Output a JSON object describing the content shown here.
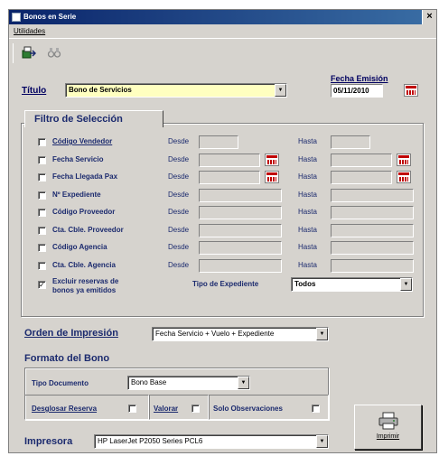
{
  "window": {
    "title": "Bonos en Serie",
    "close_glyph": "×"
  },
  "menu": {
    "utilidades": "Utilidades"
  },
  "toolbar": {
    "items": [
      "export-icon",
      "binoculars-icon"
    ]
  },
  "header": {
    "titulo_label": "Título",
    "titulo_value": "Bono de Servicios",
    "fecha_label": "Fecha Emisión",
    "fecha_value": "05/11/2010"
  },
  "filtro": {
    "tab_label": "Filtro de Selección",
    "desde": "Desde",
    "hasta": "Hasta",
    "rows": [
      {
        "label": "Código Vendedor"
      },
      {
        "label": "Fecha Servicio"
      },
      {
        "label": "Fecha Llegada Pax"
      },
      {
        "label": "Nº Expediente"
      },
      {
        "label": "Código Proveedor"
      },
      {
        "label": "Cta. Cble. Proveedor"
      },
      {
        "label": "Código Agencia"
      },
      {
        "label": "Cta. Cble. Agencia"
      }
    ],
    "excluir_label_1": "Excluir reservas de",
    "excluir_label_2": "bonos ya emitidos",
    "excluir_checked": "✓",
    "tipo_expediente_label": "Tipo de Expediente",
    "tipo_expediente_value": "Todos"
  },
  "orden": {
    "label": "Orden de Impresión",
    "value": "Fecha Servicio + Vuelo + Expediente"
  },
  "formato": {
    "title": "Formato del Bono",
    "tipo_doc_label": "Tipo Documento",
    "tipo_doc_value": "Bono Base",
    "desglosar_label": "Desglosar Reserva",
    "valorar_label": "Valorar",
    "observ_label": "Solo Observaciones"
  },
  "impresora": {
    "label": "Impresora",
    "value": "HP LaserJet P2050 Series PCL6"
  },
  "imprimir": {
    "label": "Imprimir"
  }
}
